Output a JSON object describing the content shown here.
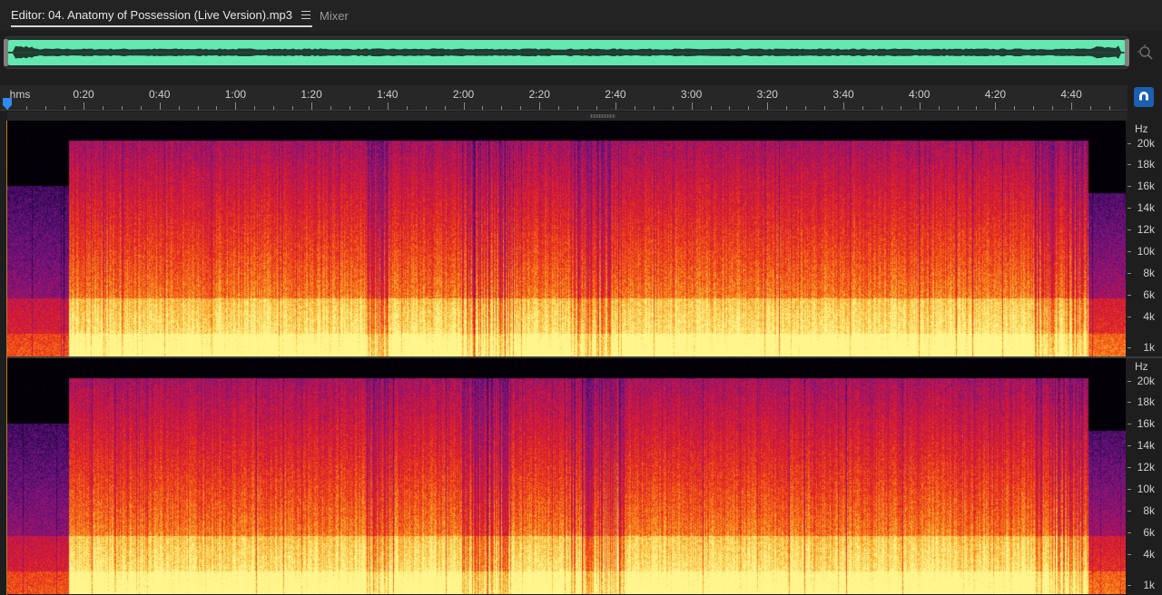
{
  "tabs": {
    "editor_label": "Editor: 04. Anatomy of Possession (Live Version).mp3",
    "mixer_label": "Mixer"
  },
  "ruler": {
    "unit": "hms",
    "labels": [
      "0:20",
      "0:40",
      "1:00",
      "1:20",
      "1:40",
      "2:00",
      "2:20",
      "2:40",
      "3:00",
      "3:20",
      "3:40",
      "4:00",
      "4:20",
      "4:40"
    ]
  },
  "frequency_scale": {
    "unit": "Hz",
    "labels": [
      "20k",
      "18k",
      "16k",
      "14k",
      "12k",
      "10k",
      "8k",
      "6k",
      "4k",
      "1k"
    ]
  },
  "colors": {
    "overview_waveform": "#63e8b0",
    "snap_button": "#1d5fb0",
    "spectrogram_low": "#000000",
    "spectrogram_mid": "#c8102e",
    "spectrogram_high": "#ffe57a"
  },
  "icons": {
    "tab_menu": "hamburger-menu-icon",
    "zoom": "zoom-magnifier-icon",
    "snap": "magnet-icon",
    "playhead": "playhead-marker-icon"
  }
}
